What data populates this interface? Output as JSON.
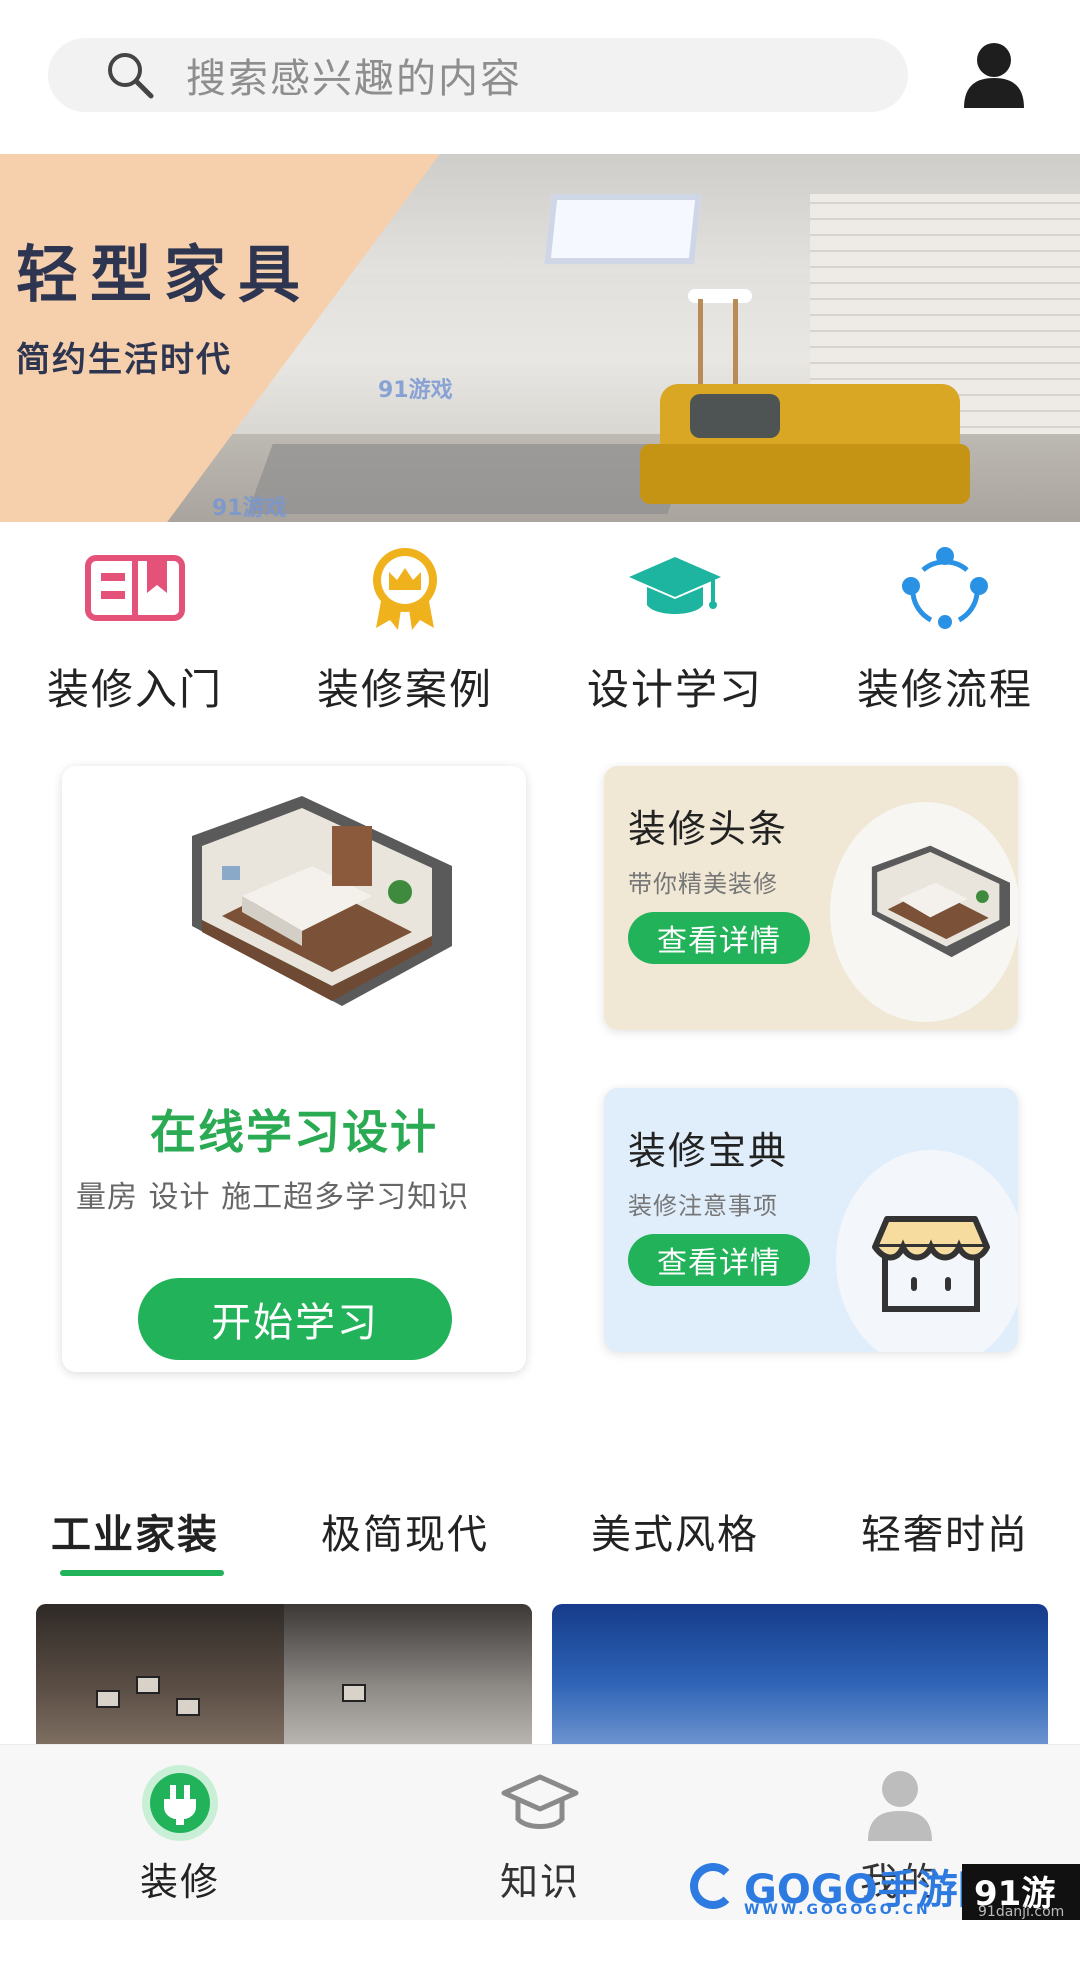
{
  "search": {
    "placeholder": "搜索感兴趣的内容",
    "icon": "search-icon"
  },
  "profile": {
    "icon": "user-icon"
  },
  "banner": {
    "title": "轻型家具",
    "subtitle": "简约生活时代",
    "watermark": "91游戏"
  },
  "quick_nav": [
    {
      "label": "装修入门",
      "icon": "book-icon",
      "color": "#e4527a"
    },
    {
      "label": "装修案例",
      "icon": "crown-medal-icon",
      "color": "#f0b21c"
    },
    {
      "label": "设计学习",
      "icon": "graduation-cap-icon",
      "color": "#1db5a0"
    },
    {
      "label": "装修流程",
      "icon": "share-nodes-icon",
      "color": "#2a92e4"
    }
  ],
  "feature_card": {
    "title": "在线学习设计",
    "description": "量房 设计 施工超多学习知识",
    "button": "开始学习"
  },
  "headline_card": {
    "title": "装修头条",
    "subtitle": "带你精美装修",
    "button": "查看详情"
  },
  "guide_card": {
    "title": "装修宝典",
    "subtitle": "装修注意事项",
    "button": "查看详情"
  },
  "tabs": [
    {
      "label": "工业家装",
      "active": true
    },
    {
      "label": "极简现代",
      "active": false
    },
    {
      "label": "美式风格",
      "active": false
    },
    {
      "label": "轻奢时尚",
      "active": false
    }
  ],
  "bottom_nav": [
    {
      "label": "装修",
      "icon": "home-plug-icon",
      "active": true
    },
    {
      "label": "知识",
      "icon": "graduation-cap-icon",
      "active": false
    },
    {
      "label": "我的",
      "icon": "user-icon",
      "active": false
    }
  ],
  "watermarks": {
    "gogo": "GOGO手游网",
    "gogo_sub": "WWW.GOGOGO.CN",
    "danji": "91游戏",
    "danji_sub": "91danji.com"
  },
  "colors": {
    "accent": "#22b35a",
    "headline_bg": "#f0e8d5",
    "guide_bg": "#e0eefb",
    "banner_peach": "#f6d0ad"
  }
}
